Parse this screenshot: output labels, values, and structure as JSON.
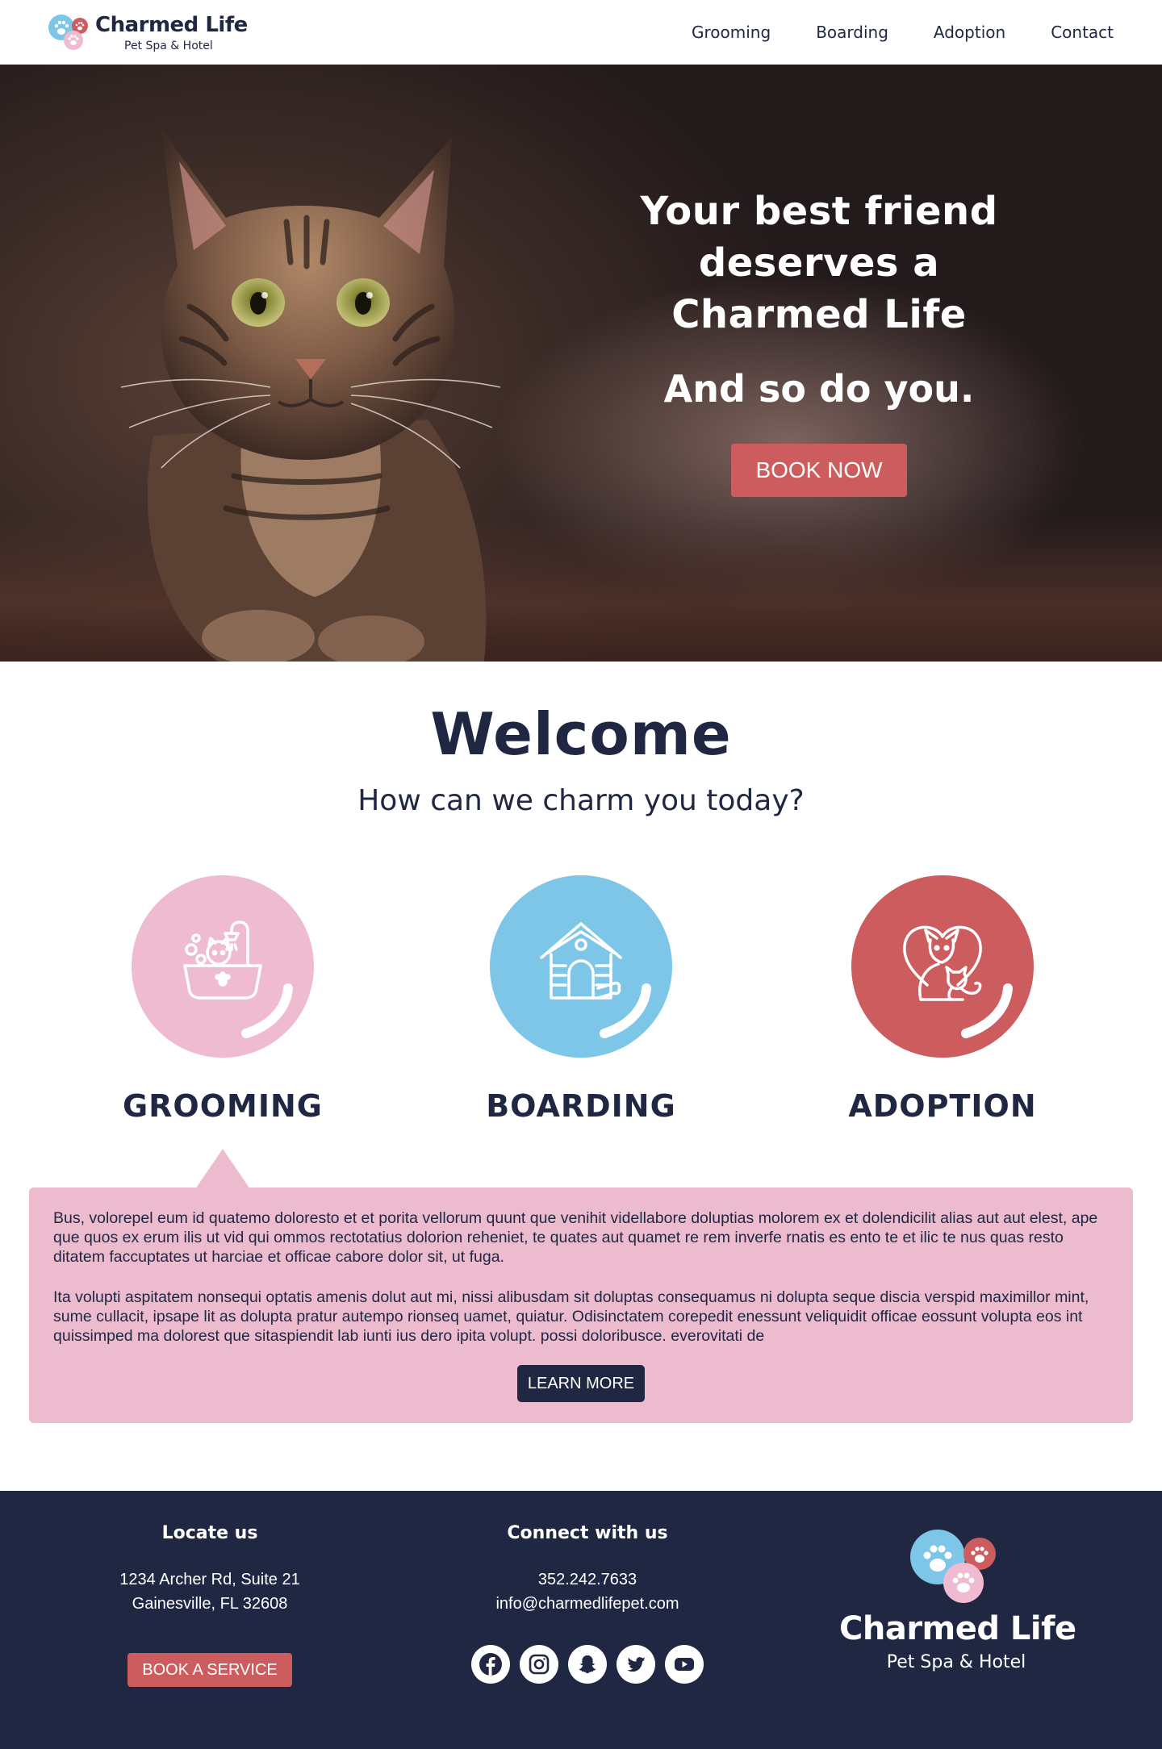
{
  "colors": {
    "navy": "#1f2742",
    "coral": "#cd5c5f",
    "pink": "#edbbce",
    "pink_circle": "#efbbd0",
    "sky": "#7ec6e8",
    "white": "#ffffff"
  },
  "header": {
    "brand": "Charmed Life",
    "tagline": "Pet Spa & Hotel",
    "nav": [
      "Grooming",
      "Boarding",
      "Adoption",
      "Contact"
    ]
  },
  "hero": {
    "title": "Your best friend deserves a Charmed Life",
    "subtitle": "And so do you.",
    "cta": "BOOK NOW",
    "image_icon": "tabby-cat-photo"
  },
  "welcome": {
    "title": "Welcome",
    "subtitle": "How can we charm you today?"
  },
  "services": [
    {
      "label": "GROOMING",
      "icon": "pet-bath-icon"
    },
    {
      "label": "BOARDING",
      "icon": "dog-house-icon"
    },
    {
      "label": "ADOPTION",
      "icon": "pets-heart-icon"
    }
  ],
  "panel": {
    "active_service": "GROOMING",
    "paragraph_1": "Bus, volorepel eum id quatemo doloresto et et porita vellorum quunt que venihit videllabore doluptias molorem ex et dolendicilit alias aut aut elest, ape que quos ex erum ilis ut vid qui ommos rectotatius dolorion reheniet, te quates aut quamet re rem inverfe rnatis es ento te et ilic te nus quas resto ditatem faccuptates ut harciae et officae cabore dolor sit, ut fuga.",
    "paragraph_2": "Ita volupti aspitatem nonsequi optatis amenis dolut aut mi, nissi alibusdam sit doluptas consequamus ni dolupta seque discia verspid maximillor mint, sume cullacit, ipsape lit as dolupta pratur autempo rionseq uamet, quiatur. Odisinctatem corepedit enessunt veliquidit officae eossunt volupta eos int quissimped ma dolorest que sitaspiendit lab iunti ius dero ipita volupt.  possi doloribusce. everovitati de",
    "cta": "LEARN MORE"
  },
  "footer": {
    "locate_title": "Locate us",
    "address_1": "1234 Archer Rd, Suite 21",
    "address_2": "Gainesville, FL 32608",
    "book_service": "BOOK A SERVICE",
    "connect_title": "Connect with us",
    "phone": "352.242.7633",
    "email": "info@charmedlifepet.com",
    "socials": [
      "facebook-icon",
      "instagram-icon",
      "snapchat-icon",
      "twitter-icon",
      "youtube-icon"
    ],
    "brand": "Charmed Life",
    "tagline": "Pet Spa & Hotel"
  }
}
